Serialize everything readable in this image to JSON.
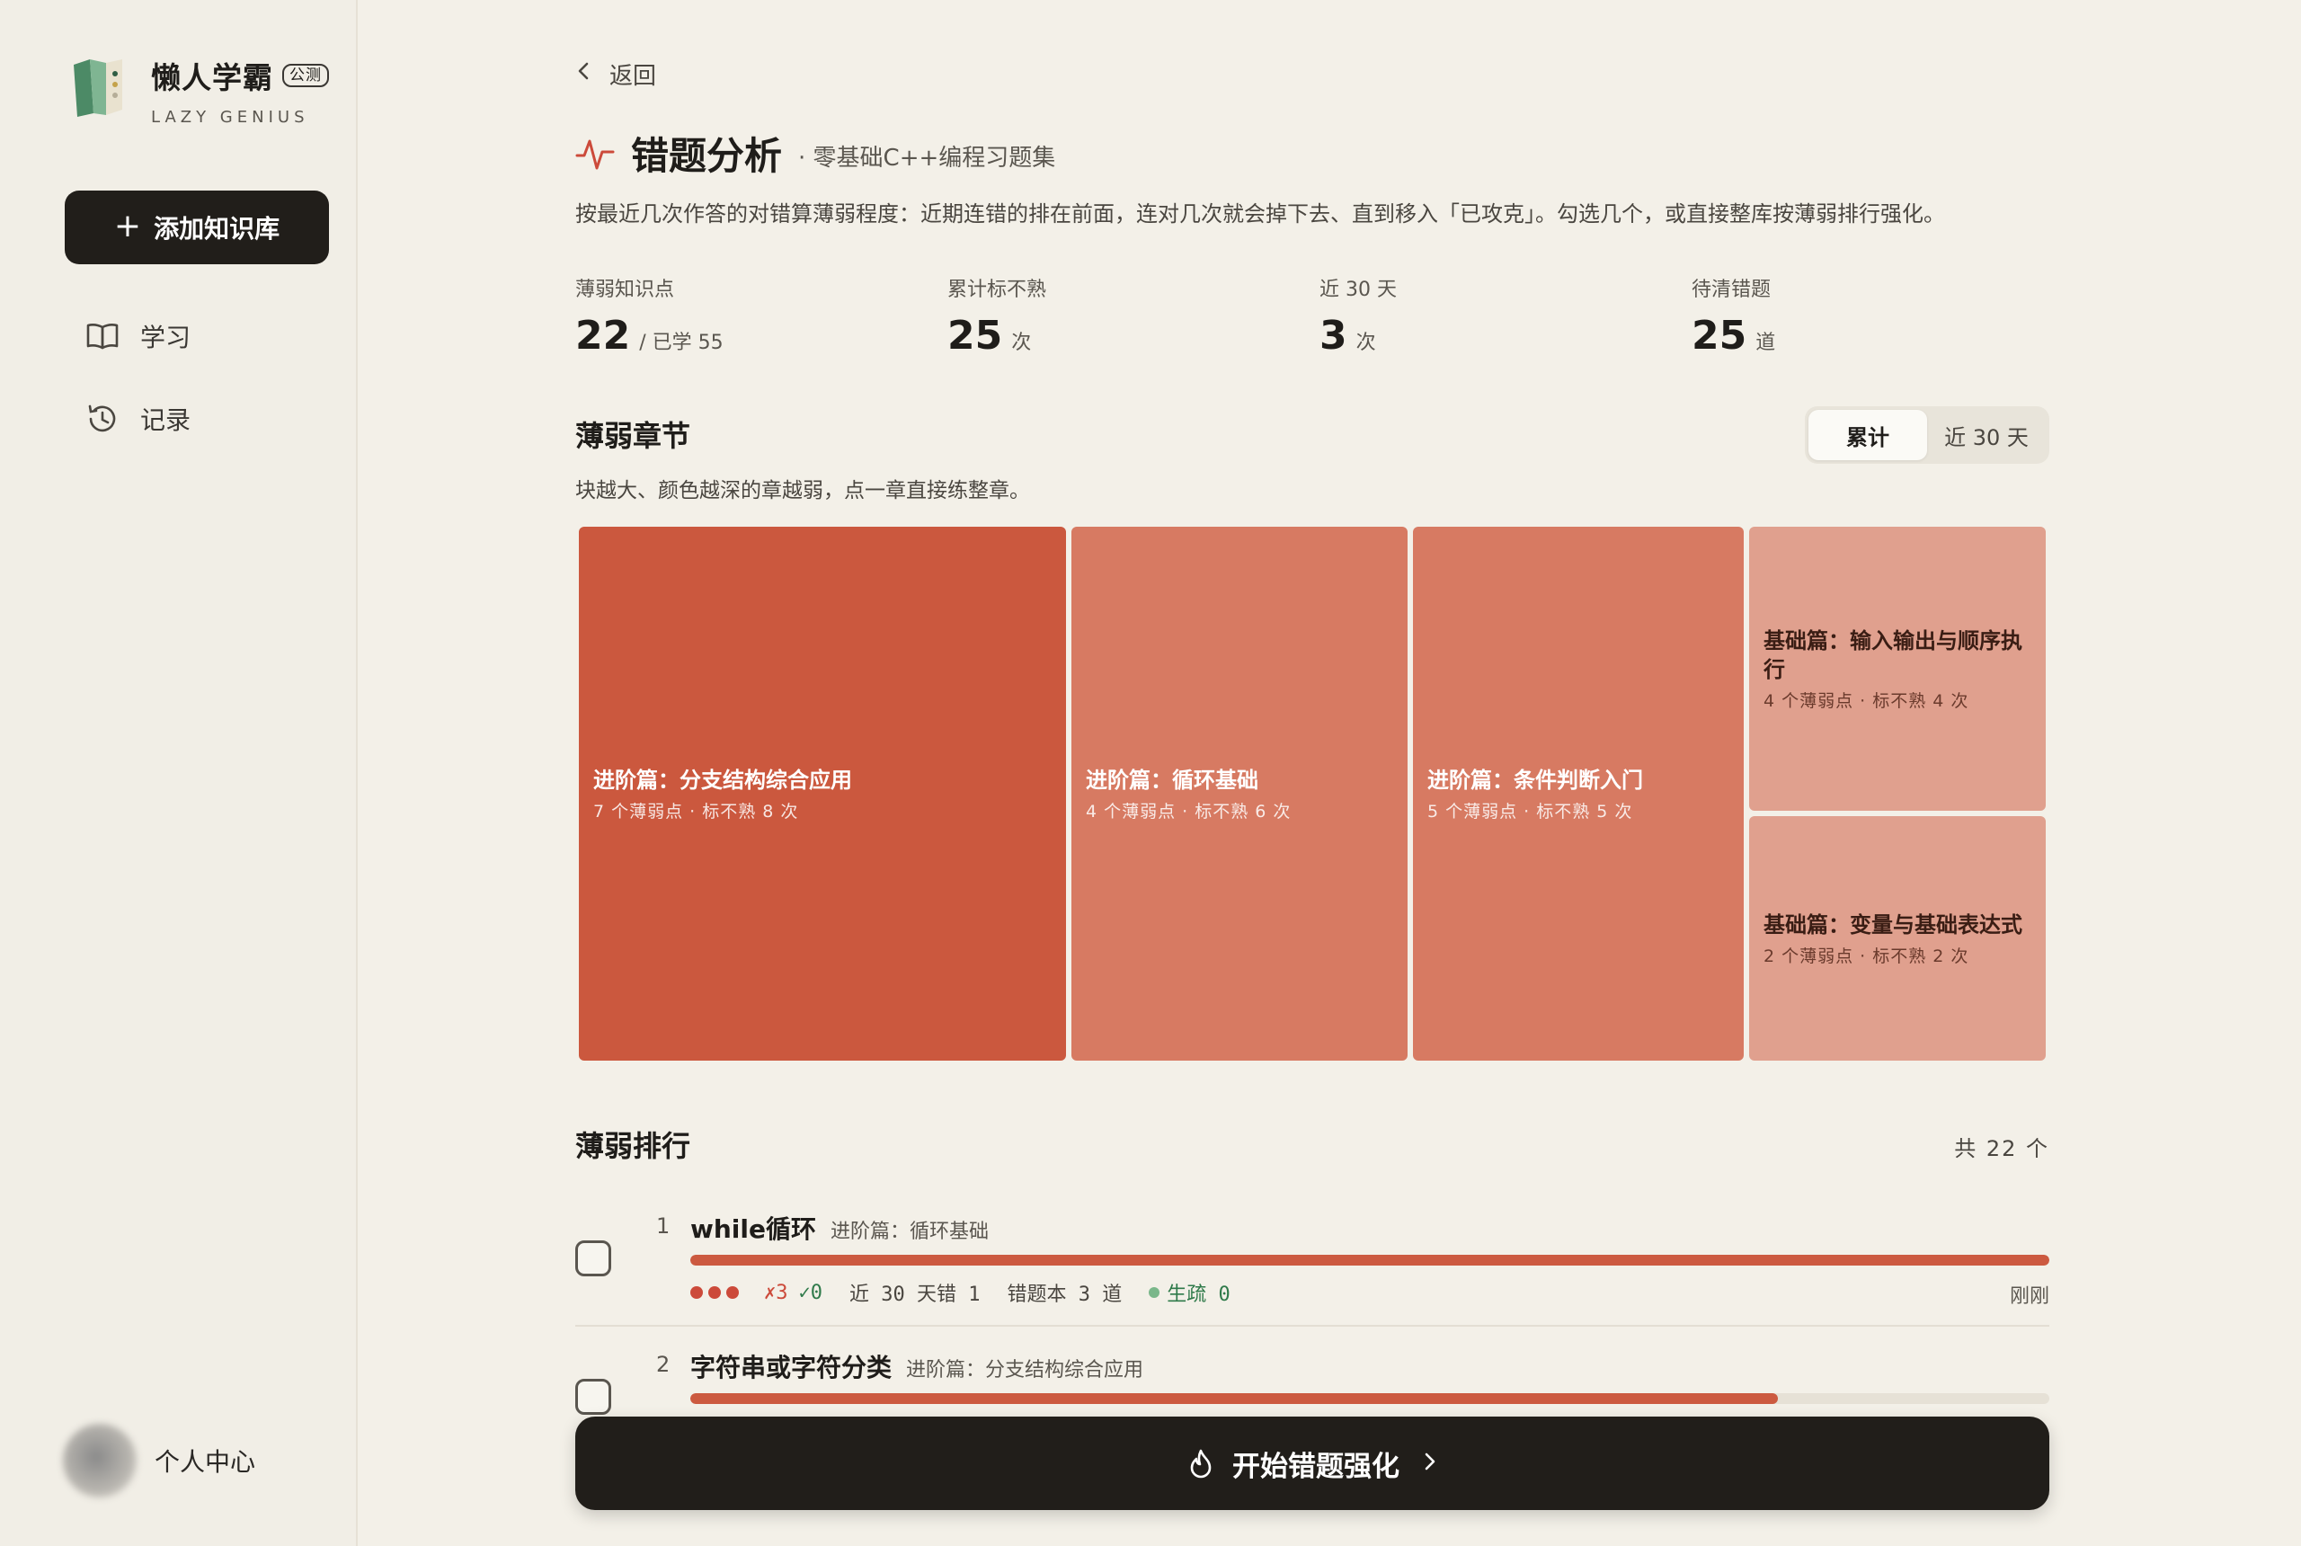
{
  "sidebar": {
    "brand": "懒人学霸",
    "badge": "公测",
    "brand_sub": "LAZY GENIUS",
    "add_label": "添加知识库",
    "nav": [
      {
        "label": "学习",
        "icon": "book-icon"
      },
      {
        "label": "记录",
        "icon": "history-icon"
      }
    ],
    "profile_label": "个人中心"
  },
  "header": {
    "back_label": "返回",
    "title": "错题分析",
    "subtitle": "· 零基础C++编程习题集",
    "description": "按最近几次作答的对错算薄弱程度：近期连错的排在前面，连对几次就会掉下去、直到移入「已攻克」。勾选几个，或直接整库按薄弱排行强化。"
  },
  "stats": [
    {
      "label": "薄弱知识点",
      "value": "22",
      "unit": "/ 已学 55"
    },
    {
      "label": "累计标不熟",
      "value": "25",
      "unit": "次"
    },
    {
      "label": "近 30 天",
      "value": "3",
      "unit": "次"
    },
    {
      "label": "待清错题",
      "value": "25",
      "unit": "道"
    }
  ],
  "chapters": {
    "title": "薄弱章节",
    "description": "块越大、颜色越深的章越弱，点一章直接练整章。",
    "toggle": [
      "累计",
      "近 30 天"
    ],
    "toggle_active": 0,
    "tiles": [
      {
        "name": "进阶篇：分支结构综合应用",
        "meta": "7 个薄弱点 · 标不熟 8 次",
        "color": "#cb583e"
      },
      {
        "name": "进阶篇：循环基础",
        "meta": "4 个薄弱点 · 标不熟 6 次",
        "color": "#d77a62"
      },
      {
        "name": "进阶篇：条件判断入门",
        "meta": "5 个薄弱点 · 标不熟 5 次",
        "color": "#d77a62"
      },
      {
        "name": "基础篇：输入输出与顺序执行",
        "meta": "4 个薄弱点 · 标不熟 4 次",
        "color": "#e0a08e"
      },
      {
        "name": "基础篇：变量与基础表达式",
        "meta": "2 个薄弱点 · 标不熟 2 次",
        "color": "#e0a08e"
      }
    ]
  },
  "ranking": {
    "title": "薄弱排行",
    "count": "共 22 个",
    "items": [
      {
        "rank": "1",
        "name": "while循环",
        "chapter": "进阶篇：循环基础",
        "weakness": 1.0,
        "wrong": "✗3",
        "right": "✓0",
        "recent": "近 30 天错 1",
        "book": "错题本 3 道",
        "status": "生疏 0",
        "time": "刚刚"
      },
      {
        "rank": "2",
        "name": "字符串或字符分类",
        "chapter": "进阶篇：分支结构综合应用",
        "weakness": 0.8
      }
    ]
  },
  "cta_label": "开始错题强化"
}
